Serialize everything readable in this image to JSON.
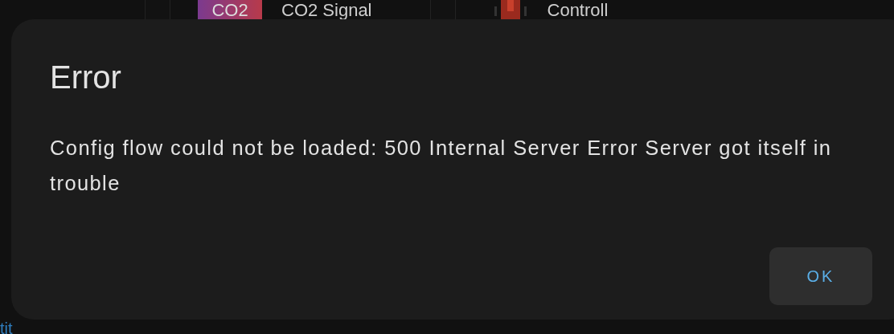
{
  "background": {
    "integrations": [
      {
        "logo": "CO2",
        "title": "CO2 Signal"
      },
      {
        "title": "Controll"
      }
    ],
    "link": "tit"
  },
  "dialog": {
    "title": "Error",
    "message": "Config flow could not be loaded: 500 Internal Server Error Server got itself in trouble",
    "buttons": [
      {
        "label": "OK"
      }
    ]
  }
}
